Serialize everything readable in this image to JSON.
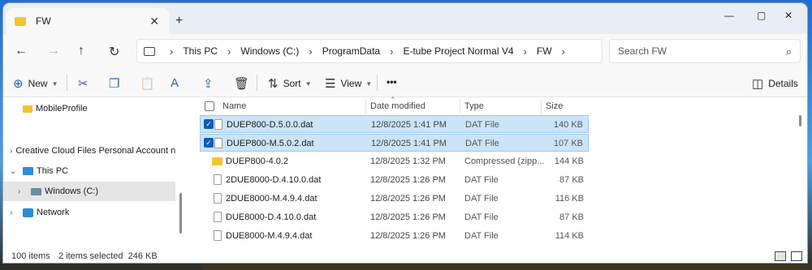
{
  "window": {
    "tab_title": "FW",
    "new_tab": "+",
    "tab_close": "✕",
    "minimize": "—",
    "maximize": "▢",
    "close": "✕"
  },
  "nav": {
    "back": "←",
    "forward": "→",
    "up": "↑",
    "refresh": "↻"
  },
  "address": {
    "crumbs": [
      "This PC",
      "Windows (C:)",
      "ProgramData",
      "E-tube Project Normal V4",
      "FW"
    ],
    "separator": "›"
  },
  "search": {
    "placeholder": "Search FW",
    "icon": "⌕"
  },
  "toolbar": {
    "new_label": "New",
    "sort_label": "Sort",
    "view_label": "View",
    "more_label": "•••",
    "details_label": "Details",
    "icons": {
      "new": "⊕",
      "cut": "✂",
      "copy": "❐",
      "paste": "📋",
      "rename": "A",
      "share": "⇪",
      "delete": "🗑",
      "sort": "⇅",
      "view": "☰",
      "details": "◫"
    }
  },
  "sidebar": {
    "items": [
      {
        "label": "MobileProfile",
        "chevron": ""
      },
      {
        "label": "Creative Cloud Files Personal Account na",
        "chevron": "›"
      },
      {
        "label": "This PC",
        "chevron": "⌄"
      },
      {
        "label": "Windows (C:)",
        "chevron": "›"
      },
      {
        "label": "Network",
        "chevron": "›"
      }
    ]
  },
  "columns": {
    "name": "Name",
    "date": "Date modified",
    "type": "Type",
    "size": "Size",
    "sort_indicator": "⌃"
  },
  "files": [
    {
      "name": "DUEP800-D.5.0.0.dat",
      "date": "12/8/2025 1:41 PM",
      "type": "DAT File",
      "size": "140 KB",
      "selected": true
    },
    {
      "name": "DUEP800-M.5.0.2.dat",
      "date": "12/8/2025 1:41 PM",
      "type": "DAT File",
      "size": "107 KB",
      "selected": true
    },
    {
      "name": "DUEP800-4.0.2",
      "date": "12/8/2025 1:32 PM",
      "type": "Compressed (zipp...",
      "size": "144 KB",
      "selected": false
    },
    {
      "name": "2DUE8000-D.4.10.0.dat",
      "date": "12/8/2025 1:26 PM",
      "type": "DAT File",
      "size": "87 KB",
      "selected": false
    },
    {
      "name": "2DUE8000-M.4.9.4.dat",
      "date": "12/8/2025 1:26 PM",
      "type": "DAT File",
      "size": "116 KB",
      "selected": false
    },
    {
      "name": "DUE8000-D.4.10.0.dat",
      "date": "12/8/2025 1:26 PM",
      "type": "DAT File",
      "size": "87 KB",
      "selected": false
    },
    {
      "name": "DUE8000-M.4.9.4.dat",
      "date": "12/8/2025 1:26 PM",
      "type": "DAT File",
      "size": "114 KB",
      "selected": false
    }
  ],
  "status": {
    "count": "100 items",
    "selection": "2 items selected  246 KB"
  },
  "check_mark": "✓"
}
